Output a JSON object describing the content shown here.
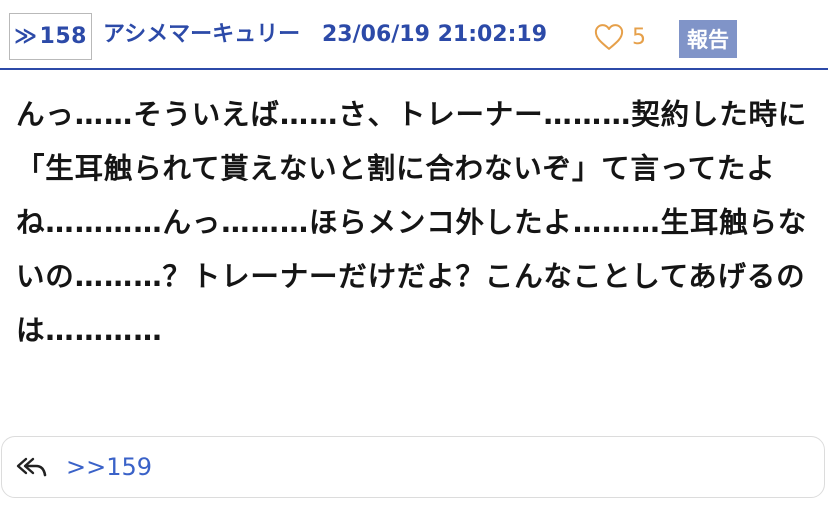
{
  "post": {
    "number_prefix": "≫",
    "number": "158",
    "author": "アシメマーキュリー",
    "timestamp": "23/06/19 21:02:19",
    "like_count": "5",
    "report_label": "報告",
    "body": "んっ……そういえば……さ、トレーナー………契約した時に「生耳触られて貰えないと割に合わないぞ」て言ってたよね…………んっ………ほらメンコ外したよ………生耳触らないの………？トレーナーだけだよ？こんなことしてあげるのは…………"
  },
  "replies": {
    "links": [
      ">>159"
    ]
  },
  "icons": {
    "like": "heart-outline-icon",
    "reply": "reply-all-icon"
  },
  "colors": {
    "accent": "#2c4aa8",
    "like": "#e6a04a",
    "report_bg": "#8094c8",
    "reply_link": "#3a62c8",
    "text": "#151515"
  }
}
